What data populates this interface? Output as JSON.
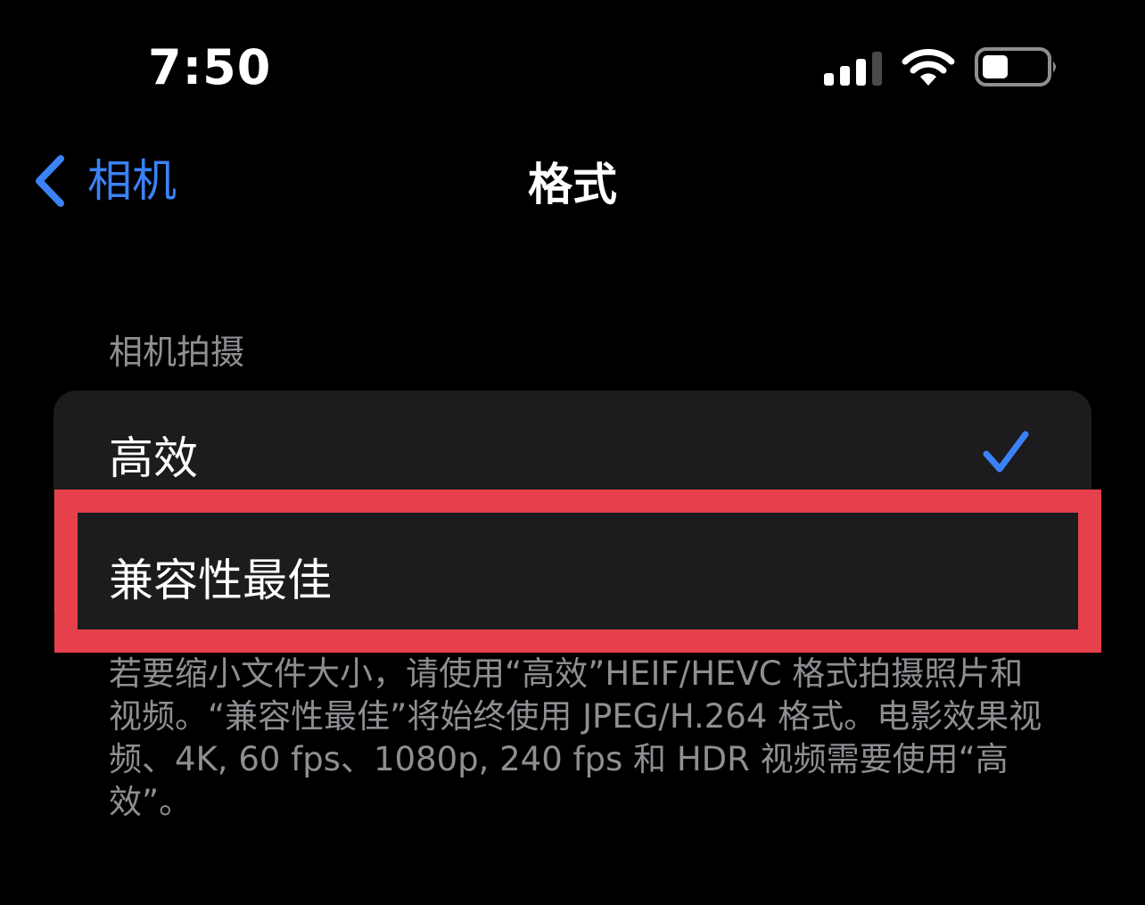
{
  "status_bar": {
    "time": "7:50",
    "signal_icon": "cellular-signal-icon",
    "wifi_icon": "wifi-icon",
    "battery_icon": "battery-icon"
  },
  "nav": {
    "back_label": "相机",
    "title": "格式"
  },
  "section": {
    "header": "相机拍摄",
    "options": [
      {
        "label": "高效",
        "selected": true
      },
      {
        "label": "兼容性最佳",
        "selected": false
      }
    ],
    "footer": "若要缩小文件大小，请使用“高效”HEIF/HEVC 格式拍摄照片和视频。“兼容性最佳”将始终使用 JPEG/H.264 格式。电影效果视频、4K, 60 fps、1080p, 240 fps 和 HDR 视频需要使用“高效”。"
  },
  "colors": {
    "accent": "#3b82f6",
    "highlight": "#e5404b",
    "background": "#000000",
    "group_background": "#1c1c1e",
    "secondary_text": "#8e8e93"
  }
}
